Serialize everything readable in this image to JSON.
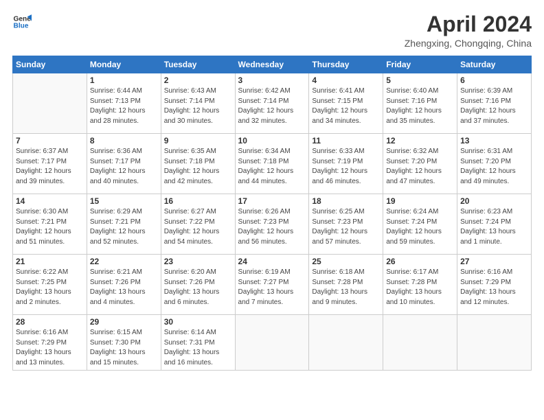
{
  "logo": {
    "line1": "General",
    "line2": "Blue"
  },
  "title": "April 2024",
  "subtitle": "Zhengxing, Chongqing, China",
  "header_days": [
    "Sunday",
    "Monday",
    "Tuesday",
    "Wednesday",
    "Thursday",
    "Friday",
    "Saturday"
  ],
  "weeks": [
    [
      {
        "day": "",
        "info": ""
      },
      {
        "day": "1",
        "info": "Sunrise: 6:44 AM\nSunset: 7:13 PM\nDaylight: 12 hours\nand 28 minutes."
      },
      {
        "day": "2",
        "info": "Sunrise: 6:43 AM\nSunset: 7:14 PM\nDaylight: 12 hours\nand 30 minutes."
      },
      {
        "day": "3",
        "info": "Sunrise: 6:42 AM\nSunset: 7:14 PM\nDaylight: 12 hours\nand 32 minutes."
      },
      {
        "day": "4",
        "info": "Sunrise: 6:41 AM\nSunset: 7:15 PM\nDaylight: 12 hours\nand 34 minutes."
      },
      {
        "day": "5",
        "info": "Sunrise: 6:40 AM\nSunset: 7:16 PM\nDaylight: 12 hours\nand 35 minutes."
      },
      {
        "day": "6",
        "info": "Sunrise: 6:39 AM\nSunset: 7:16 PM\nDaylight: 12 hours\nand 37 minutes."
      }
    ],
    [
      {
        "day": "7",
        "info": "Sunrise: 6:37 AM\nSunset: 7:17 PM\nDaylight: 12 hours\nand 39 minutes."
      },
      {
        "day": "8",
        "info": "Sunrise: 6:36 AM\nSunset: 7:17 PM\nDaylight: 12 hours\nand 40 minutes."
      },
      {
        "day": "9",
        "info": "Sunrise: 6:35 AM\nSunset: 7:18 PM\nDaylight: 12 hours\nand 42 minutes."
      },
      {
        "day": "10",
        "info": "Sunrise: 6:34 AM\nSunset: 7:18 PM\nDaylight: 12 hours\nand 44 minutes."
      },
      {
        "day": "11",
        "info": "Sunrise: 6:33 AM\nSunset: 7:19 PM\nDaylight: 12 hours\nand 46 minutes."
      },
      {
        "day": "12",
        "info": "Sunrise: 6:32 AM\nSunset: 7:20 PM\nDaylight: 12 hours\nand 47 minutes."
      },
      {
        "day": "13",
        "info": "Sunrise: 6:31 AM\nSunset: 7:20 PM\nDaylight: 12 hours\nand 49 minutes."
      }
    ],
    [
      {
        "day": "14",
        "info": "Sunrise: 6:30 AM\nSunset: 7:21 PM\nDaylight: 12 hours\nand 51 minutes."
      },
      {
        "day": "15",
        "info": "Sunrise: 6:29 AM\nSunset: 7:21 PM\nDaylight: 12 hours\nand 52 minutes."
      },
      {
        "day": "16",
        "info": "Sunrise: 6:27 AM\nSunset: 7:22 PM\nDaylight: 12 hours\nand 54 minutes."
      },
      {
        "day": "17",
        "info": "Sunrise: 6:26 AM\nSunset: 7:23 PM\nDaylight: 12 hours\nand 56 minutes."
      },
      {
        "day": "18",
        "info": "Sunrise: 6:25 AM\nSunset: 7:23 PM\nDaylight: 12 hours\nand 57 minutes."
      },
      {
        "day": "19",
        "info": "Sunrise: 6:24 AM\nSunset: 7:24 PM\nDaylight: 12 hours\nand 59 minutes."
      },
      {
        "day": "20",
        "info": "Sunrise: 6:23 AM\nSunset: 7:24 PM\nDaylight: 13 hours\nand 1 minute."
      }
    ],
    [
      {
        "day": "21",
        "info": "Sunrise: 6:22 AM\nSunset: 7:25 PM\nDaylight: 13 hours\nand 2 minutes."
      },
      {
        "day": "22",
        "info": "Sunrise: 6:21 AM\nSunset: 7:26 PM\nDaylight: 13 hours\nand 4 minutes."
      },
      {
        "day": "23",
        "info": "Sunrise: 6:20 AM\nSunset: 7:26 PM\nDaylight: 13 hours\nand 6 minutes."
      },
      {
        "day": "24",
        "info": "Sunrise: 6:19 AM\nSunset: 7:27 PM\nDaylight: 13 hours\nand 7 minutes."
      },
      {
        "day": "25",
        "info": "Sunrise: 6:18 AM\nSunset: 7:28 PM\nDaylight: 13 hours\nand 9 minutes."
      },
      {
        "day": "26",
        "info": "Sunrise: 6:17 AM\nSunset: 7:28 PM\nDaylight: 13 hours\nand 10 minutes."
      },
      {
        "day": "27",
        "info": "Sunrise: 6:16 AM\nSunset: 7:29 PM\nDaylight: 13 hours\nand 12 minutes."
      }
    ],
    [
      {
        "day": "28",
        "info": "Sunrise: 6:16 AM\nSunset: 7:29 PM\nDaylight: 13 hours\nand 13 minutes."
      },
      {
        "day": "29",
        "info": "Sunrise: 6:15 AM\nSunset: 7:30 PM\nDaylight: 13 hours\nand 15 minutes."
      },
      {
        "day": "30",
        "info": "Sunrise: 6:14 AM\nSunset: 7:31 PM\nDaylight: 13 hours\nand 16 minutes."
      },
      {
        "day": "",
        "info": ""
      },
      {
        "day": "",
        "info": ""
      },
      {
        "day": "",
        "info": ""
      },
      {
        "day": "",
        "info": ""
      }
    ]
  ]
}
